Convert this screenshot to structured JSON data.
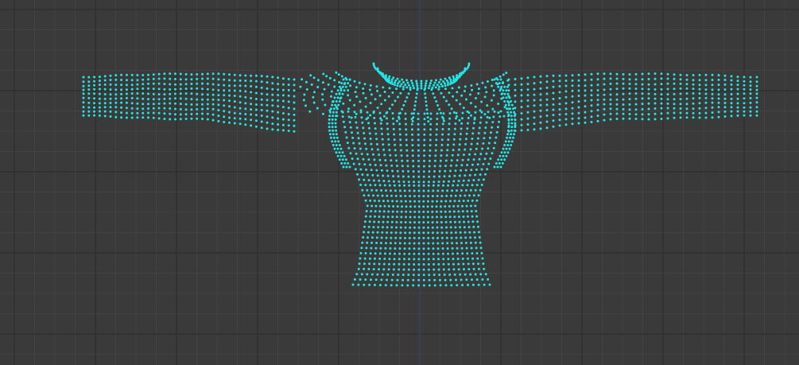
{
  "viewport": {
    "view": "front-orthographic",
    "display_mode": "vertex-points"
  },
  "colors": {
    "background": "#3a3a3a",
    "grid_minor": "#434343",
    "grid_major": "#2f2f2f",
    "axis_vertical": "#3c4a7a",
    "vertex": "#22e6e6"
  },
  "icons": {
    "object": "garment-point-cloud-icon"
  }
}
